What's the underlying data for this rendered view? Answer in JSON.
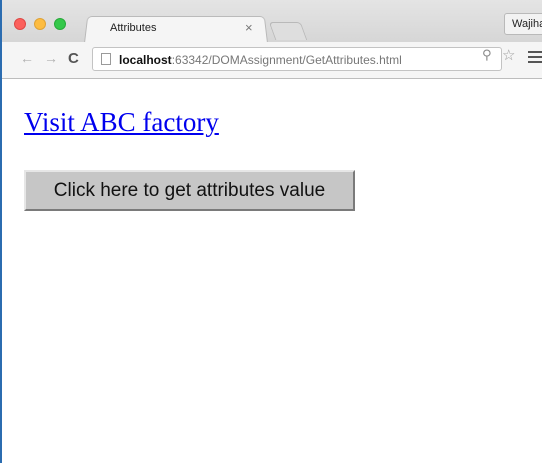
{
  "browser": {
    "tab": {
      "title": "Attributes",
      "close_glyph": "×"
    },
    "profile_name": "Wajiha",
    "address": {
      "host": "localhost",
      "path": ":63342/DOMAssignment/GetAttributes.html"
    },
    "icons": {
      "back": "back-arrow-icon",
      "forward": "forward-arrow-icon",
      "reload": "reload-icon",
      "page": "page-icon",
      "zoom": "zoom-icon",
      "bookmark": "star-icon",
      "menu": "hamburger-menu-icon"
    },
    "colors": {
      "close": "#fc605c",
      "minimize": "#fdbc40",
      "maximize": "#34c84a"
    }
  },
  "page": {
    "link_text": "Visit ABC factory",
    "button_label": "Click here to get attributes value",
    "link_color": "#0000ee"
  }
}
